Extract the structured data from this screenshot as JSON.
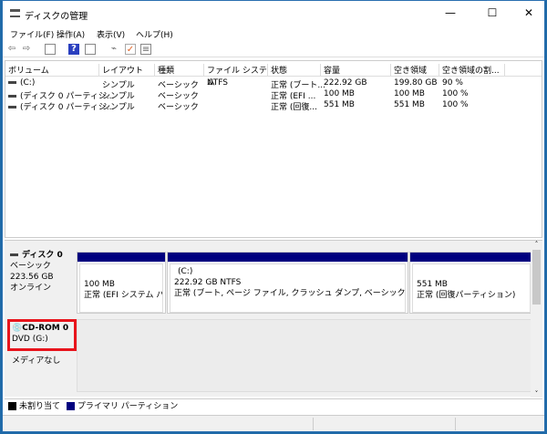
{
  "window": {
    "title": "ディスクの管理",
    "minimize": "—",
    "maximize": "☐",
    "close": "✕"
  },
  "menu": [
    "ファイル(F)",
    "操作(A)",
    "表示(V)",
    "ヘルプ(H)"
  ],
  "toolbar": [
    "back-icon",
    "forward-icon",
    "console-tree-icon",
    "help-icon",
    "action-pane-icon",
    "connect-icon",
    "check-icon",
    "properties-icon"
  ],
  "columns": [
    "ボリューム",
    "レイアウト",
    "種類",
    "ファイル システム",
    "状態",
    "容量",
    "空き領域",
    "空き領域の割..."
  ],
  "volumes": [
    [
      "(C:)",
      "シンプル",
      "ベーシック",
      "NTFS",
      "正常 (ブート...",
      "222.92 GB",
      "199.80 GB",
      "90 %"
    ],
    [
      "(ディスク 0 パーティシ...",
      "シンプル",
      "ベーシック",
      "",
      "正常 (EFI ...",
      "100 MB",
      "100 MB",
      "100 %"
    ],
    [
      "(ディスク 0 パーティシ...",
      "シンプル",
      "ベーシック",
      "",
      "正常 (回復...",
      "551 MB",
      "551 MB",
      "100 %"
    ]
  ],
  "disk0": {
    "name": "ディスク 0",
    "type": "ベーシック",
    "size": "223.56 GB",
    "status": "オンライン",
    "partitions": [
      {
        "label": "",
        "size": "100 MB",
        "status": "正常 (EFI システム パーティション)"
      },
      {
        "label": "(C:)",
        "size": "222.92 GB NTFS",
        "status": "正常 (ブート, ページ ファイル, クラッシュ ダンプ, ベーシック データ パーティション)"
      },
      {
        "label": "",
        "size": "551 MB",
        "status": "正常 (回復パーティション)"
      }
    ]
  },
  "cdrom": {
    "name": "CD-ROM 0",
    "drive": "DVD (G:)",
    "media": "メディアなし"
  },
  "legend": [
    {
      "label": "未割り当て",
      "color": "#000000"
    },
    {
      "label": "プライマリ パーティション",
      "color": "#00007f"
    }
  ],
  "colors": {
    "partition_bar": "#00007f",
    "highlight": "#e8141c"
  }
}
